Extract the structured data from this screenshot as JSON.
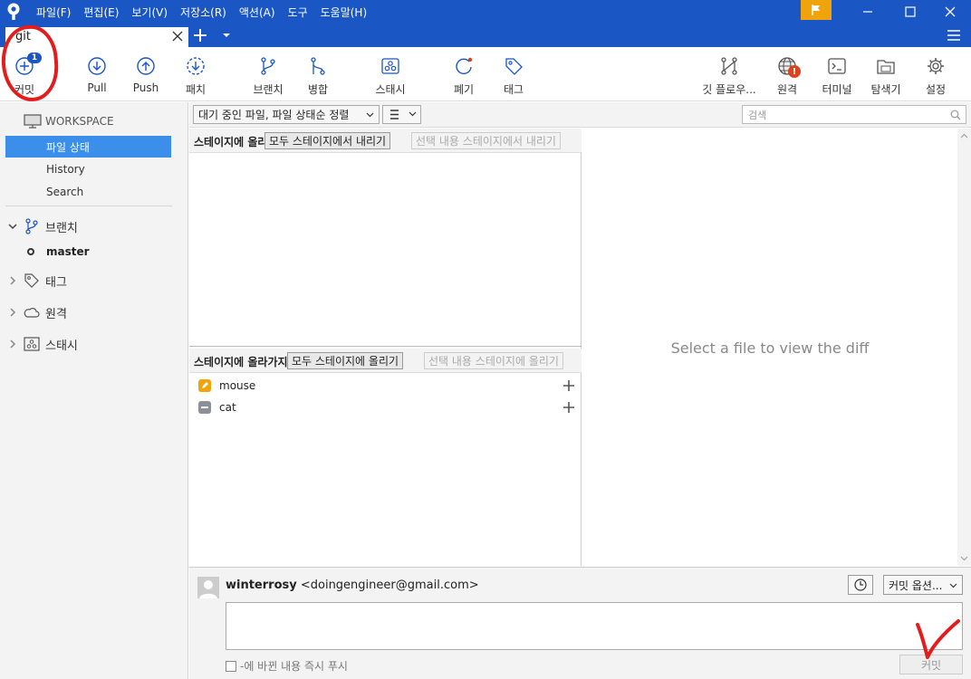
{
  "menu": [
    "파일(F)",
    "편집(E)",
    "보기(V)",
    "저장소(R)",
    "액션(A)",
    "도구",
    "도움말(H)"
  ],
  "tab": {
    "label": "git"
  },
  "toolbar": {
    "commit": "커밋",
    "commit_badge": "1",
    "pull": "Pull",
    "push": "Push",
    "patch": "패치",
    "branch": "브랜치",
    "merge": "병합",
    "stash": "스태시",
    "discard": "폐기",
    "tag": "태그",
    "gitflow": "깃 플로우...",
    "remote": "원격",
    "remote_badge": "!",
    "terminal": "터미널",
    "explorer": "탐색기",
    "settings": "설정"
  },
  "sidebar": {
    "workspace": "WORKSPACE",
    "items": [
      "파일 상태",
      "History",
      "Search"
    ],
    "groups": {
      "branches": "브랜치",
      "tags": "태그",
      "remotes": "원격",
      "stashes": "스태시"
    },
    "current_branch": "master"
  },
  "filter": {
    "sort": "대기 중인 파일, 파일 상태순 정렬",
    "search_placeholder": "검색"
  },
  "staged": {
    "title": "스테이지에 올라간 파일",
    "unstage_all": "모두 스테이지에서 내리기",
    "unstage_selected": "선택 내용 스테이지에서 내리기"
  },
  "unstaged": {
    "title": "스테이지에 올라가지 않은 파일",
    "stage_all": "모두 스테이지에 올리기",
    "stage_selected": "선택 내용 스테이지에 올리기",
    "files": [
      {
        "name": "mouse",
        "status": "modified",
        "color": "#f0a30a"
      },
      {
        "name": "cat",
        "status": "removed",
        "color": "#8a8f98"
      }
    ]
  },
  "diff": {
    "empty_message": "Select a file to view the diff"
  },
  "commit": {
    "author_name": "winterrosy",
    "author_email": "<doingengineer@gmail.com>",
    "options": "커밋 옵션...",
    "push_immediately": "-에 바뀐 내용 즉시 푸시",
    "button": "커밋"
  },
  "colors": {
    "accent": "#1a56c4",
    "selection": "#3b8eea",
    "flag": "#f0a30a",
    "annotation": "#e31c1c"
  }
}
